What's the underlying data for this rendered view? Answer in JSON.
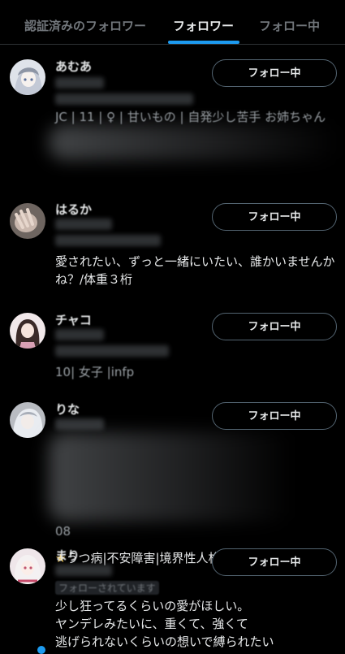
{
  "tabs": [
    {
      "label": "認証済みのフォロワー",
      "active": false
    },
    {
      "label": "フォロワー",
      "active": true
    },
    {
      "label": "フォロー中",
      "active": false
    }
  ],
  "accent_color": "#1d9bf0",
  "followers": [
    {
      "name": "あむあ",
      "button_label": "フォロー中",
      "bio": "JC | 11 | ♀ | 甘いもの | 自発少し苦手 お姉ちゃん"
    },
    {
      "name": "はるか",
      "button_label": "フォロー中",
      "bio": "愛されたい、ずっと一緒にいたい、誰かいませんかね？/体重３桁"
    },
    {
      "name": "チャコ",
      "button_label": "フォロー中",
      "bio": "10| 女子 |infp"
    },
    {
      "name": "りな",
      "button_label": "フォロー中",
      "bio_line1": "08",
      "bio_line2": "うつ病|不安障害|境界性人格障害"
    },
    {
      "name": "まり",
      "button_label": "フォロー中",
      "follows_you": "フォローされています",
      "bio": "少し狂ってるくらいの愛がほしい。\nヤンデレみたいに、重くて、強くて\n逃げられないくらいの想いで縛られたい"
    }
  ]
}
